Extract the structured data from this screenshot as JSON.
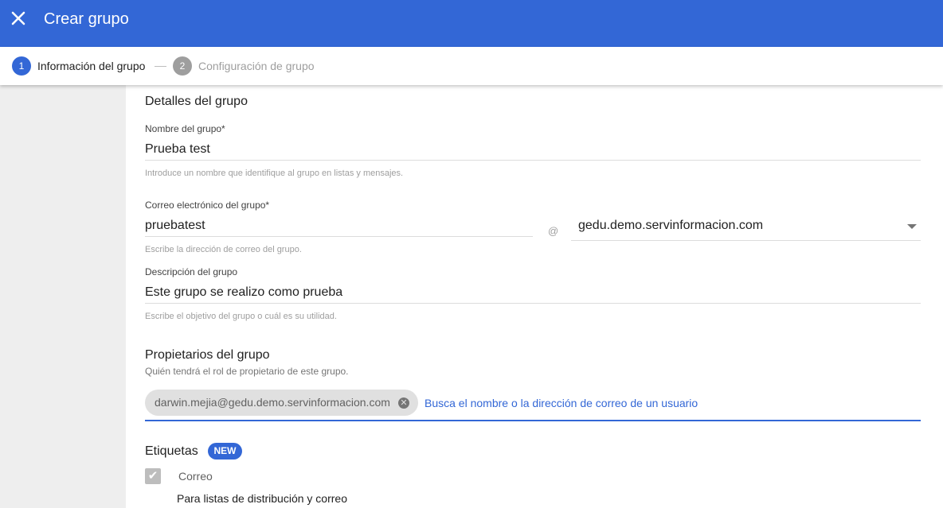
{
  "header": {
    "title": "Crear grupo",
    "close_icon": "close-icon"
  },
  "stepper": {
    "steps": [
      {
        "number": "1",
        "label": "Información del grupo",
        "active": true
      },
      {
        "number": "2",
        "label": "Configuración de grupo",
        "active": false
      }
    ]
  },
  "details": {
    "section_title": "Detalles del grupo",
    "name": {
      "label": "Nombre del grupo*",
      "value": "Prueba test",
      "hint": "Introduce un nombre que identifique al grupo en listas y mensajes."
    },
    "email": {
      "label": "Correo electrónico del grupo*",
      "value": "pruebatest",
      "at": "@",
      "domain": "gedu.demo.servinformacion.com",
      "hint": "Escribe la dirección de correo del grupo."
    },
    "description": {
      "label": "Descripción del grupo",
      "value": "Este grupo se realizo como prueba",
      "hint": "Escribe el objetivo del grupo o cuál es su utilidad."
    }
  },
  "owners": {
    "section_title": "Propietarios del grupo",
    "subtitle": "Quién tendrá el rol de propietario de este grupo.",
    "chip": "darwin.mejia@gedu.demo.servinformacion.com",
    "search_placeholder": "Busca el nombre o la dirección de correo de un usuario"
  },
  "labels": {
    "section_title": "Etiquetas",
    "badge": "NEW",
    "option_label": "Correo",
    "option_description": "Para listas de distribución y correo",
    "option_checked": true
  },
  "colors": {
    "primary": "#3367d6",
    "side_panel": "#eeeeee",
    "chip_bg": "#e0e0e0"
  }
}
